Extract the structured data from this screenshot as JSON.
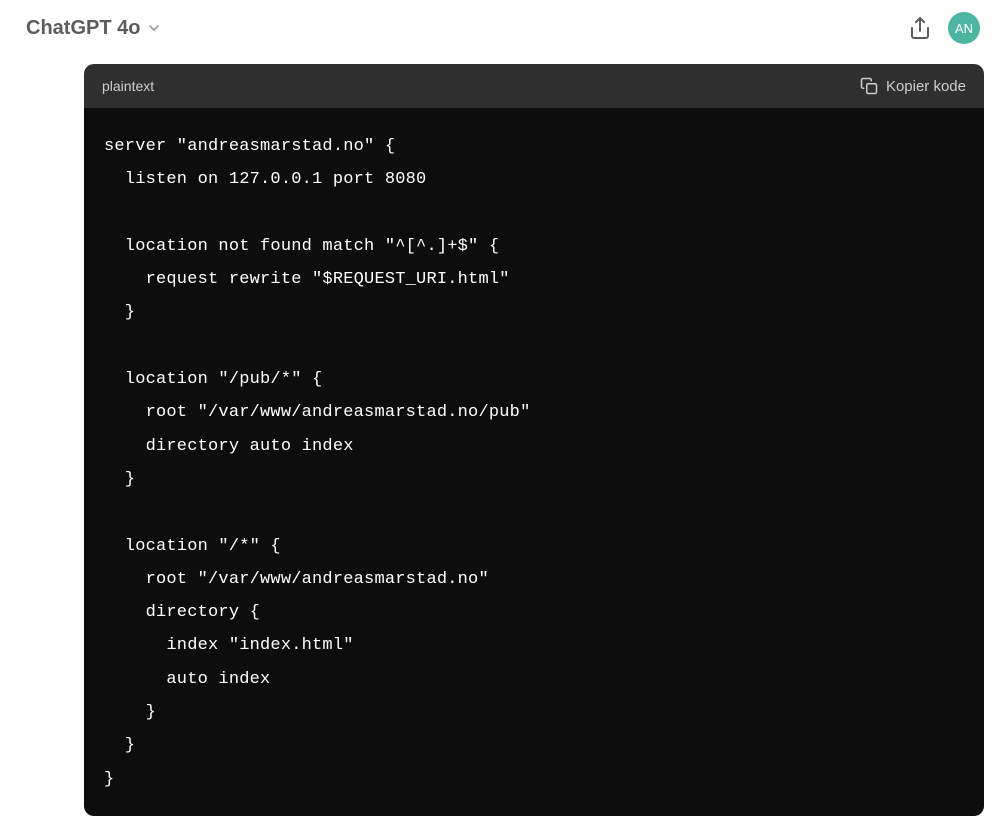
{
  "header": {
    "model_name": "ChatGPT 4o",
    "avatar_initials": "AN"
  },
  "code_block": {
    "language": "plaintext",
    "copy_label": "Kopier kode",
    "code": "server \"andreasmarstad.no\" {\n  listen on 127.0.0.1 port 8080\n\n  location not found match \"^[^.]+$\" {\n    request rewrite \"$REQUEST_URI.html\"\n  }\n\n  location \"/pub/*\" {\n    root \"/var/www/andreasmarstad.no/pub\"\n    directory auto index\n  }\n\n  location \"/*\" {\n    root \"/var/www/andreasmarstad.no\"\n    directory {\n      index \"index.html\"\n      auto index\n    }\n  }\n}"
  }
}
